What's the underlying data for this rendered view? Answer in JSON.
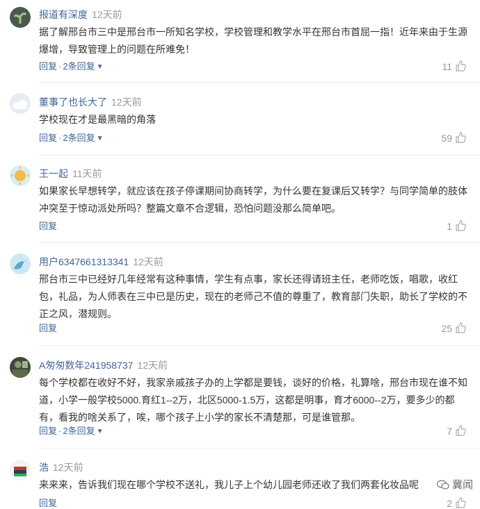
{
  "comments": [
    {
      "user": "报道有深度",
      "time": "12天前",
      "text": "据了解邢台市三中是邢台市一所知名学校，学校管理和教学水平在邢台市首屈一指！近年来由于生源爆增，导致管理上的问题在所难免！",
      "reply": "回复",
      "replies_count": "2条回复",
      "likes": "11",
      "avatar": "dark-plant-avatar"
    },
    {
      "user": "董事了也长大了",
      "time": "12天前",
      "text": "学校现在才是最黑暗的角落",
      "reply": "回复",
      "replies_count": "2条回复",
      "likes": "59",
      "avatar": "cloud-avatar"
    },
    {
      "user": "王一起",
      "time": "11天前",
      "text": "如果家长早想转学，就应该在孩子停课期间协商转学，为什么要在复课后又转学？与同学简单的肢体冲突至于惊动派处所吗？整篇文章不合逻辑，恐怕问题没那么简单吧。",
      "reply": "回复",
      "replies_count": "",
      "likes": "1",
      "avatar": "sun-avatar"
    },
    {
      "user": "用户6347661313341",
      "time": "12天前",
      "text": "邢台市三中已经好几年经常有这种事情，学生有点事，家长还得请班主任，老师吃饭，唱歌，收红包，礼品，为人师表在三中已是历史，现在的老师己不值的尊重了，教育部门失职，助长了学校的不正之风，潜规则。",
      "reply": "回复",
      "replies_count": "",
      "likes": "25",
      "avatar": "bird-avatar"
    },
    {
      "user": "A匆匆数年241958737",
      "time": "12天前",
      "text": "每个学校都在收好不好，我家亲戚孩子办的上学都是要钱，谈好的价格，礼算啥，邢台市现在谁不知道，小学一般学校5000.育红1--2万，北区5000-1.5万，这都是明事，育才6000--2万，要多少的都有，看我的啥关系了，唉，哪个孩子上小学的家长不清楚那，可是谁管那。",
      "reply": "回复",
      "replies_count": "2条回复",
      "likes": "7",
      "avatar": "photo-avatar"
    },
    {
      "user": "浩",
      "time": "12天前",
      "text": "来来来，告诉我们现在哪个学校不送礼，我儿子上个幼儿园老师还收了我们两套化妆品呢",
      "reply": "回复",
      "replies_count": "",
      "likes": "2",
      "avatar": "flag-avatar"
    }
  ],
  "watermark": "冀闻",
  "colors": {
    "username": "#406599",
    "time": "#999999",
    "text": "#333333",
    "action": "#406599"
  },
  "icons": {
    "like": "thumbs-up-icon",
    "expand": "chevron-down-icon",
    "watermark": "wechat-icon"
  }
}
